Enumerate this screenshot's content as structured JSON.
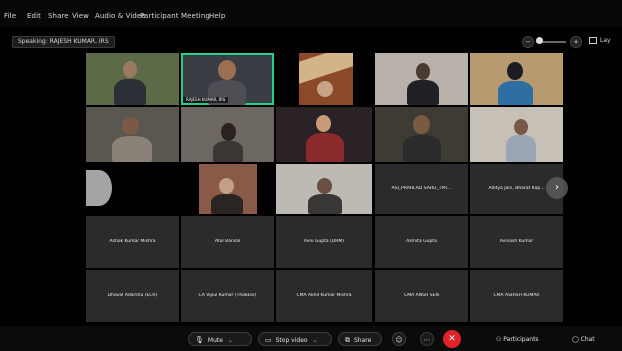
{
  "menu": [
    "File",
    "Edit",
    "Share",
    "View",
    "Audio & Video",
    "Participant",
    "Meeting",
    "Help"
  ],
  "speaking": "Speaking: RAJESH KUMAR, IRS",
  "zoom": {
    "minus": "−",
    "plus": "+"
  },
  "layout_label": "Lay",
  "active_caption": "RAJESH KUMAR, IRS",
  "name_tiles": [
    "ASI_PRAHLAD SAHU_TPR...",
    "Ashok Kumar Mishra",
    "Atul Bansal",
    "Avni Gupta (DRM)",
    "Asmita Gupta",
    "Avinash Kumar",
    "Dhaval Adarsha (ECR)",
    "CA Vipul Kumar (Thakkar)",
    "CMA Akhil Kumar Mishra",
    "CMA ANSH SEN",
    "CMA ASHISH KUMAR",
    "Aditya Jain, Bharat Kap..."
  ],
  "toolbar": {
    "mute": "Mute",
    "stop_video": "Stop video",
    "share": "Share",
    "participants": "Participants",
    "chat": "Chat",
    "participants_count": "",
    "chat_count": ""
  },
  "colors": {
    "active_border": "#23d18b",
    "end_button": "#e0232b"
  }
}
